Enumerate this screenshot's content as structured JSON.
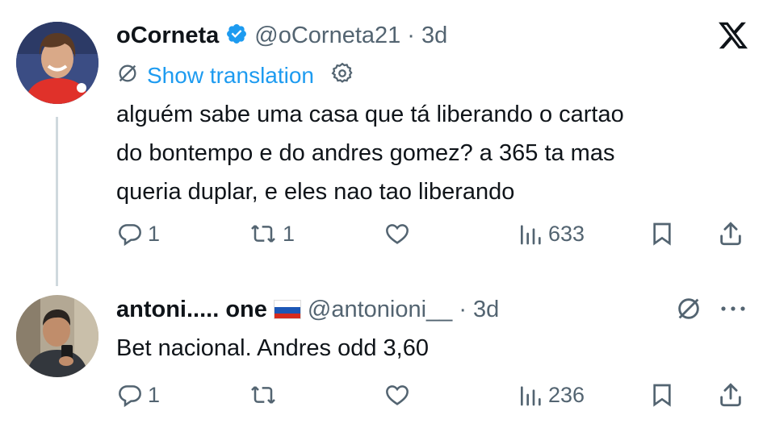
{
  "tweet": {
    "author_name": "oCorneta",
    "handle": "@oCorneta21",
    "separator": "·",
    "time": "3d",
    "show_translation": "Show translation",
    "text_lines": [
      "alguém sabe uma casa que tá liberando o cartao",
      "do bontempo e do andres gomez? a 365 ta mas",
      "queria duplar, e eles nao tao liberando"
    ],
    "replies": "1",
    "reposts": "1",
    "views": "633"
  },
  "reply": {
    "author_name": "antoni..... one",
    "flag": "🇷🇺",
    "handle": "@antonioni__",
    "separator": "·",
    "time": "3d",
    "text": "Bet nacional. Andres odd 3,60",
    "replies": "1",
    "views": "236"
  },
  "colors": {
    "text": "#0f1419",
    "secondary": "#536471",
    "link": "#1d9bf0",
    "verified": "#1d9bf0",
    "thread_line": "#cfd9de"
  }
}
